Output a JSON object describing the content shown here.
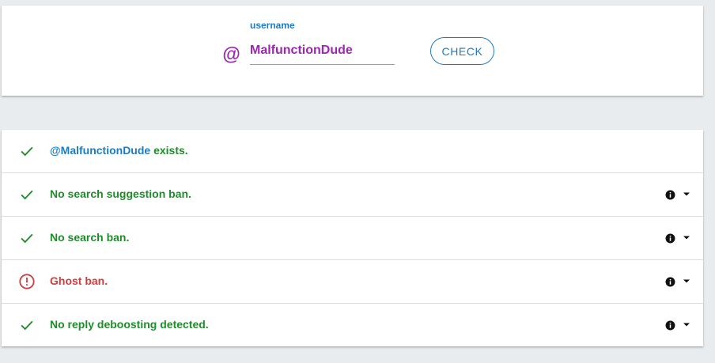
{
  "search": {
    "at_symbol": "@",
    "label": "username",
    "value": "MalfunctionDude",
    "button_label": "CHECK"
  },
  "colors": {
    "ok": "#1e8c2a",
    "bad": "#d13c3c",
    "accent": "#1e7bc0",
    "username": "#9c27b0"
  },
  "results": [
    {
      "status": "ok",
      "icon": "check-icon",
      "handle": "@MalfunctionDude",
      "text": " exists.",
      "has_info": false
    },
    {
      "status": "ok",
      "icon": "check-icon",
      "text": "No search suggestion ban.",
      "has_info": true
    },
    {
      "status": "ok",
      "icon": "check-icon",
      "text": "No search ban.",
      "has_info": true
    },
    {
      "status": "bad",
      "icon": "alert-circle-icon",
      "text": "Ghost ban.",
      "has_info": true
    },
    {
      "status": "ok",
      "icon": "check-icon",
      "text": "No reply deboosting detected.",
      "has_info": true
    }
  ]
}
